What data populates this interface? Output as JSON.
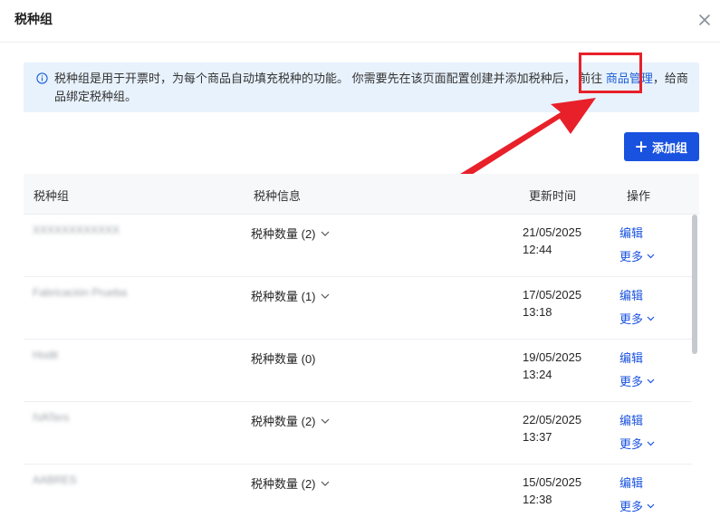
{
  "dialog": {
    "title": "税种组",
    "close_icon": "close-icon"
  },
  "notice": {
    "icon": "info-icon",
    "text_before": "税种组是用于开票时，为每个商品自动填充税种的功能。 你需要先在该页面配置创建并添加税种后， 前往",
    "link": "商品管理",
    "text_after": "，给商品绑定税种组。"
  },
  "annotation": {
    "highlight_color": "#e8202a"
  },
  "toolbar": {
    "add_label": "添加组"
  },
  "table": {
    "columns": [
      "税种组",
      "税种信息",
      "更新时间",
      "操作"
    ],
    "rows": [
      {
        "name": "XXXXXXXXXXXX",
        "count": "税种数量 (2)",
        "has_dropdown": true,
        "date": "21/05/2025",
        "time": "12:44",
        "edit": "编辑",
        "more": "更多"
      },
      {
        "name": "Fabricación Prueba",
        "count": "税种数量 (1)",
        "has_dropdown": true,
        "date": "17/05/2025",
        "time": "13:18",
        "edit": "编辑",
        "more": "更多"
      },
      {
        "name": "Hodit",
        "count": "税种数量 (0)",
        "has_dropdown": false,
        "date": "19/05/2025",
        "time": "13:24",
        "edit": "编辑",
        "more": "更多"
      },
      {
        "name": "IVATers",
        "count": "税种数量 (2)",
        "has_dropdown": true,
        "date": "22/05/2025",
        "time": "13:37",
        "edit": "编辑",
        "more": "更多"
      },
      {
        "name": "AABRES",
        "count": "税种数量 (2)",
        "has_dropdown": true,
        "date": "15/05/2025",
        "time": "12:38",
        "edit": "编辑",
        "more": "更多"
      }
    ]
  },
  "colors": {
    "accent": "#1a52e0",
    "notice_bg": "#e8f2fd",
    "link": "#1a5fd6"
  }
}
